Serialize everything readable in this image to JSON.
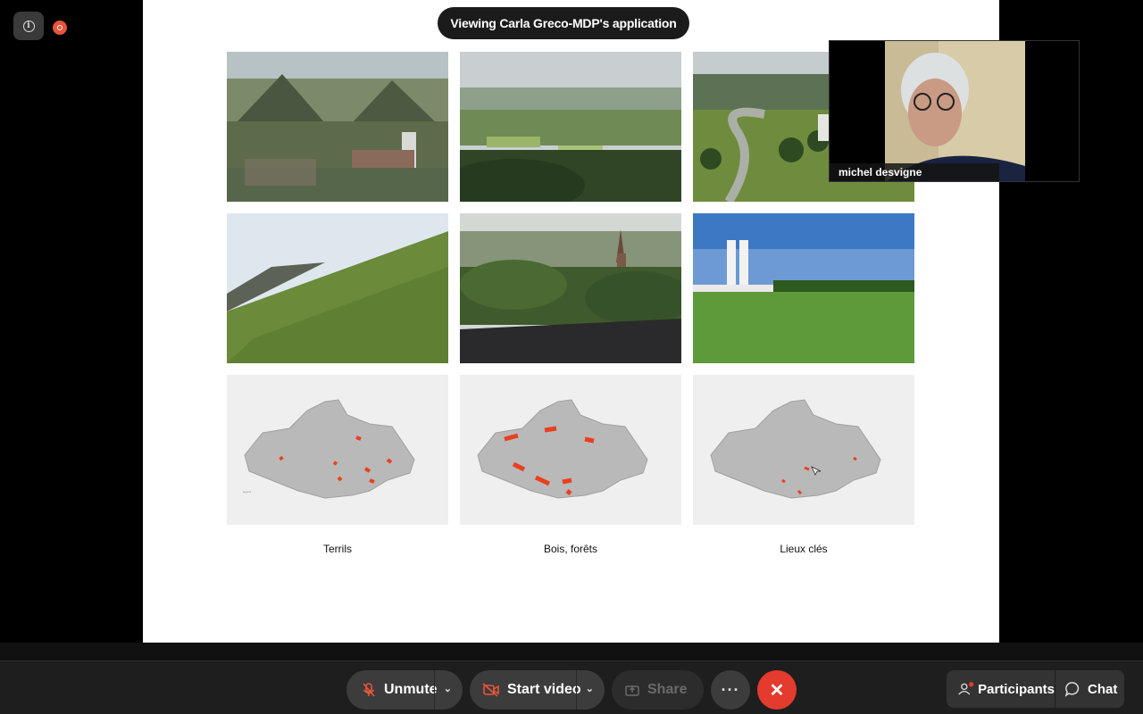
{
  "banner": {
    "text": "Viewing Carla Greco-MDP's application"
  },
  "slide": {
    "captions": [
      "Terrils",
      "Bois, forêts",
      "Lieux clés"
    ]
  },
  "video": {
    "participant_name": "michel desvigne"
  },
  "toolbar": {
    "unmute_label": "Unmute",
    "start_video_label": "Start video",
    "share_label": "Share",
    "more_label": "···",
    "participants_label": "Participants",
    "chat_label": "Chat"
  },
  "colors": {
    "end_call": "#e33b2e",
    "record_indicator": "#e8543c",
    "muted_icon": "#e8543c",
    "toolbar_bg": "#1e1e1e",
    "map_highlight": "#e8401f"
  },
  "icons": {
    "info": "info-icon",
    "record": "record-icon",
    "mic_off": "mic-off-icon",
    "video_off": "video-off-icon",
    "share": "share-icon",
    "more": "more-icon",
    "end": "close-icon",
    "participants": "people-icon",
    "chat": "chat-icon"
  }
}
